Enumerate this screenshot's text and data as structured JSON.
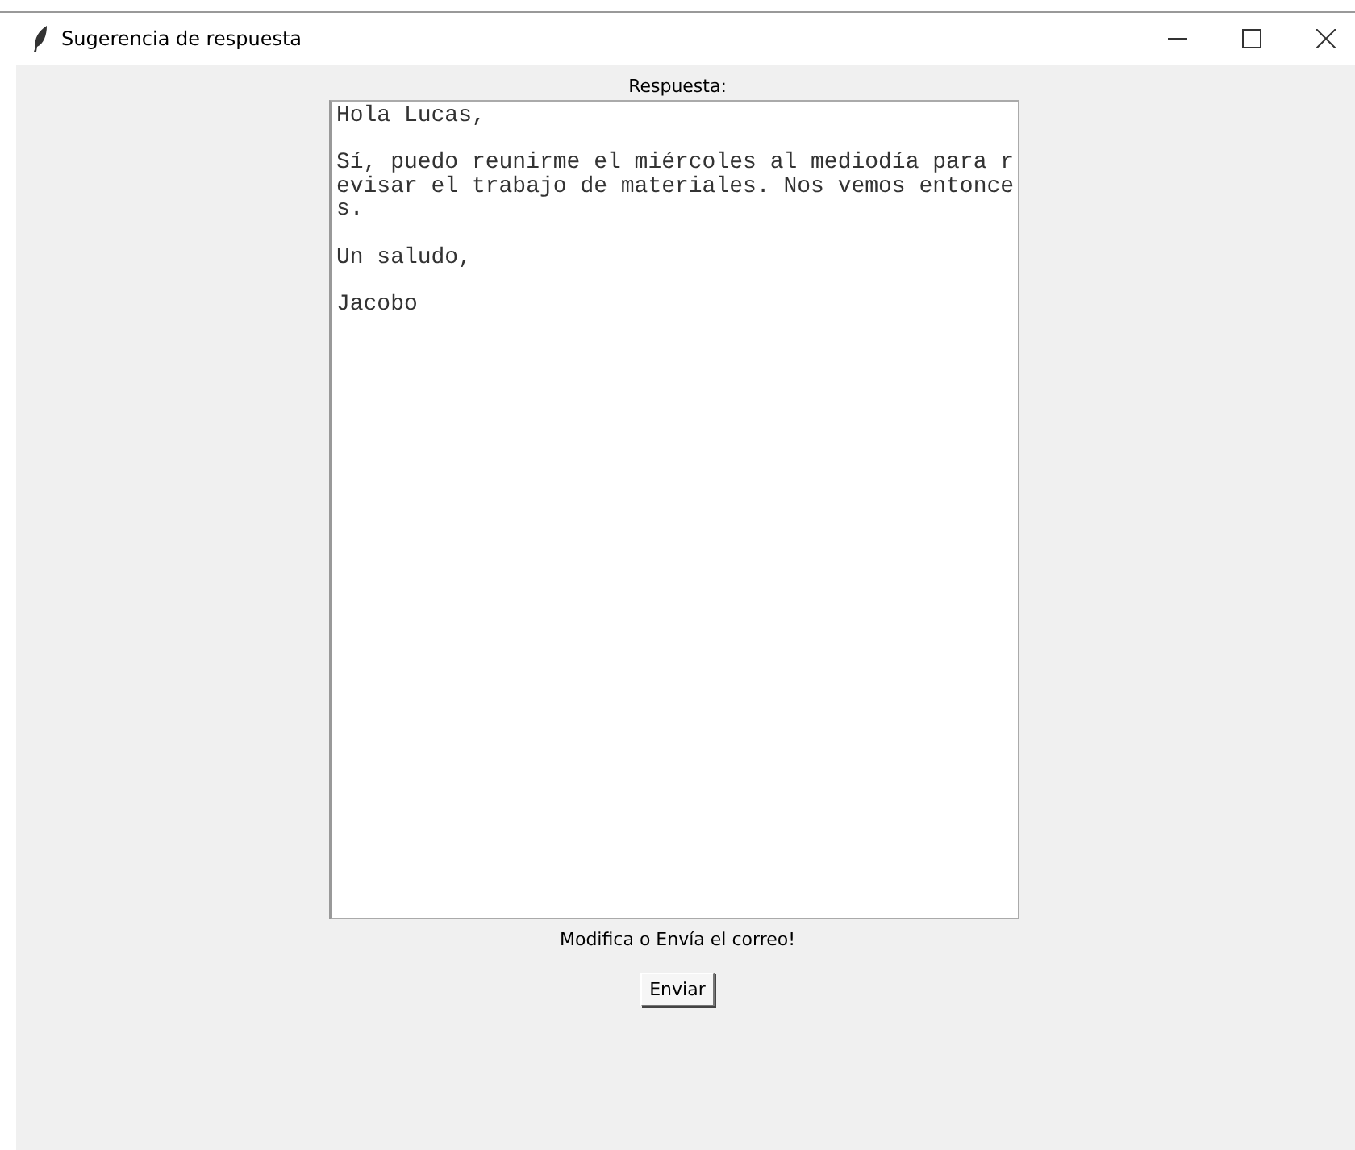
{
  "window": {
    "title": "Sugerencia de respuesta"
  },
  "label": "Respuesta:",
  "reply": {
    "paragraphs": [
      "Hola Lucas,",
      "Sí, puedo reunirme el miércoles al mediodía para revisar el trabajo de materiales. Nos vemos entonces.",
      "Un saludo,",
      "Jacobo"
    ]
  },
  "hint": "Modifica o Envía el correo!",
  "buttons": [
    "Enviar"
  ]
}
